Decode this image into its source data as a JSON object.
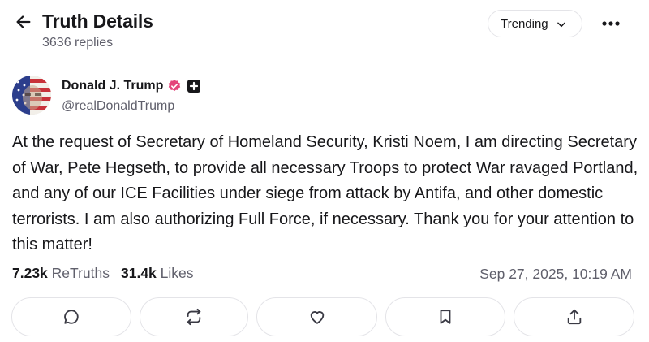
{
  "header": {
    "title": "Truth Details",
    "replies": "3636 replies",
    "sort_label": "Trending"
  },
  "post": {
    "author_name": "Donald J. Trump",
    "handle": "@realDonaldTrump",
    "text": "At the request of Secretary of Homeland Security, Kristi Noem, I am directing Secretary of War, Pete Hegseth, to provide all necessary Troops to protect War ravaged Portland, and any of our ICE Facilities under siege from attack by Antifa, and other domestic terrorists. I am also authorizing Full Force, if necessary. Thank you for your attention to this matter!",
    "retruths_count": "7.23k",
    "retruths_label": "ReTruths",
    "likes_count": "31.4k",
    "likes_label": "Likes",
    "timestamp": "Sep 27, 2025, 10:19 AM"
  },
  "actions": [
    {
      "icon": "reply-icon"
    },
    {
      "icon": "retruth-icon"
    },
    {
      "icon": "heart-icon"
    },
    {
      "icon": "bookmark-icon"
    },
    {
      "icon": "share-icon"
    }
  ],
  "colors": {
    "text": "#17171a",
    "muted": "#60606c",
    "border": "#e4e4e8",
    "verified": "#e4447a"
  }
}
